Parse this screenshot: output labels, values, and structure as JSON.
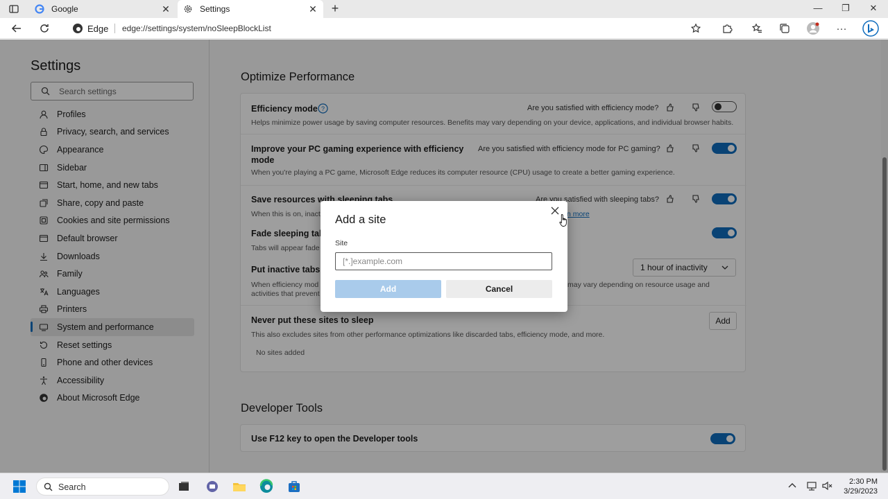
{
  "tabs": [
    {
      "label": "Google",
      "icon": "google-icon"
    },
    {
      "label": "Settings",
      "icon": "gear-icon"
    }
  ],
  "address_bar": {
    "identity": "Edge",
    "url": "edge://settings/system/noSleepBlockList"
  },
  "sidebar": {
    "title": "Settings",
    "search_placeholder": "Search settings",
    "items": [
      {
        "label": "Profiles",
        "icon": "profile-icon"
      },
      {
        "label": "Privacy, search, and services",
        "icon": "lock-icon"
      },
      {
        "label": "Appearance",
        "icon": "appearance-icon"
      },
      {
        "label": "Sidebar",
        "icon": "sidebar-icon"
      },
      {
        "label": "Start, home, and new tabs",
        "icon": "home-icon"
      },
      {
        "label": "Share, copy and paste",
        "icon": "share-icon"
      },
      {
        "label": "Cookies and site permissions",
        "icon": "cookie-icon"
      },
      {
        "label": "Default browser",
        "icon": "browser-icon"
      },
      {
        "label": "Downloads",
        "icon": "download-icon"
      },
      {
        "label": "Family",
        "icon": "family-icon"
      },
      {
        "label": "Languages",
        "icon": "language-icon"
      },
      {
        "label": "Printers",
        "icon": "printer-icon"
      },
      {
        "label": "System and performance",
        "icon": "system-icon"
      },
      {
        "label": "Reset settings",
        "icon": "reset-icon"
      },
      {
        "label": "Phone and other devices",
        "icon": "phone-icon"
      },
      {
        "label": "Accessibility",
        "icon": "accessibility-icon"
      },
      {
        "label": "About Microsoft Edge",
        "icon": "edge-icon"
      }
    ],
    "active_index": 12
  },
  "optimize": {
    "title": "Optimize Performance",
    "efficiency": {
      "title": "Efficiency mode",
      "question": "Are you satisfied with efficiency mode?",
      "desc": "Helps minimize power usage by saving computer resources. Benefits may vary depending on your device, applications, and individual browser habits.",
      "enabled": false
    },
    "gaming": {
      "title_line1": "Improve your PC gaming experience with efficiency",
      "title_line2": "mode",
      "question": "Are you satisfied with efficiency mode for PC gaming?",
      "desc": "When you're playing a PC game, Microsoft Edge reduces its computer resource (CPU) usage to create a better gaming experience.",
      "enabled": true
    },
    "sleeping": {
      "title": "Save resources with sleeping tabs",
      "question": "Are you satisfied with sleeping tabs?",
      "desc": "When this is on, inact",
      "learn_more": "n more",
      "enabled": true
    },
    "fade": {
      "title": "Fade sleeping tabs",
      "desc": "Tabs will appear fade",
      "enabled": true
    },
    "inactive": {
      "title": "Put inactive tabs t",
      "desc_line1_left": "When efficiency mod",
      "desc_line1_right": "may vary depending on resource usage and",
      "desc_line2": "activities that prevent",
      "dropdown_value": "1 hour of inactivity"
    },
    "never_sleep": {
      "title": "Never put these sites to sleep",
      "desc": "This also excludes sites from other performance optimizations like discarded tabs, efficiency mode, and more.",
      "empty": "No sites added",
      "add_label": "Add"
    }
  },
  "developer": {
    "title": "Developer Tools",
    "f12": {
      "title": "Use F12 key to open the Developer tools",
      "enabled": true
    }
  },
  "dialog": {
    "title": "Add a site",
    "field_label": "Site",
    "placeholder": "[*.]example.com",
    "add_label": "Add",
    "cancel_label": "Cancel"
  },
  "taskbar": {
    "search_label": "Search",
    "time": "2:30 PM",
    "date": "3/29/2023"
  },
  "colors": {
    "accent": "#0f6cbd",
    "add_disabled": "#a9cbeb"
  }
}
